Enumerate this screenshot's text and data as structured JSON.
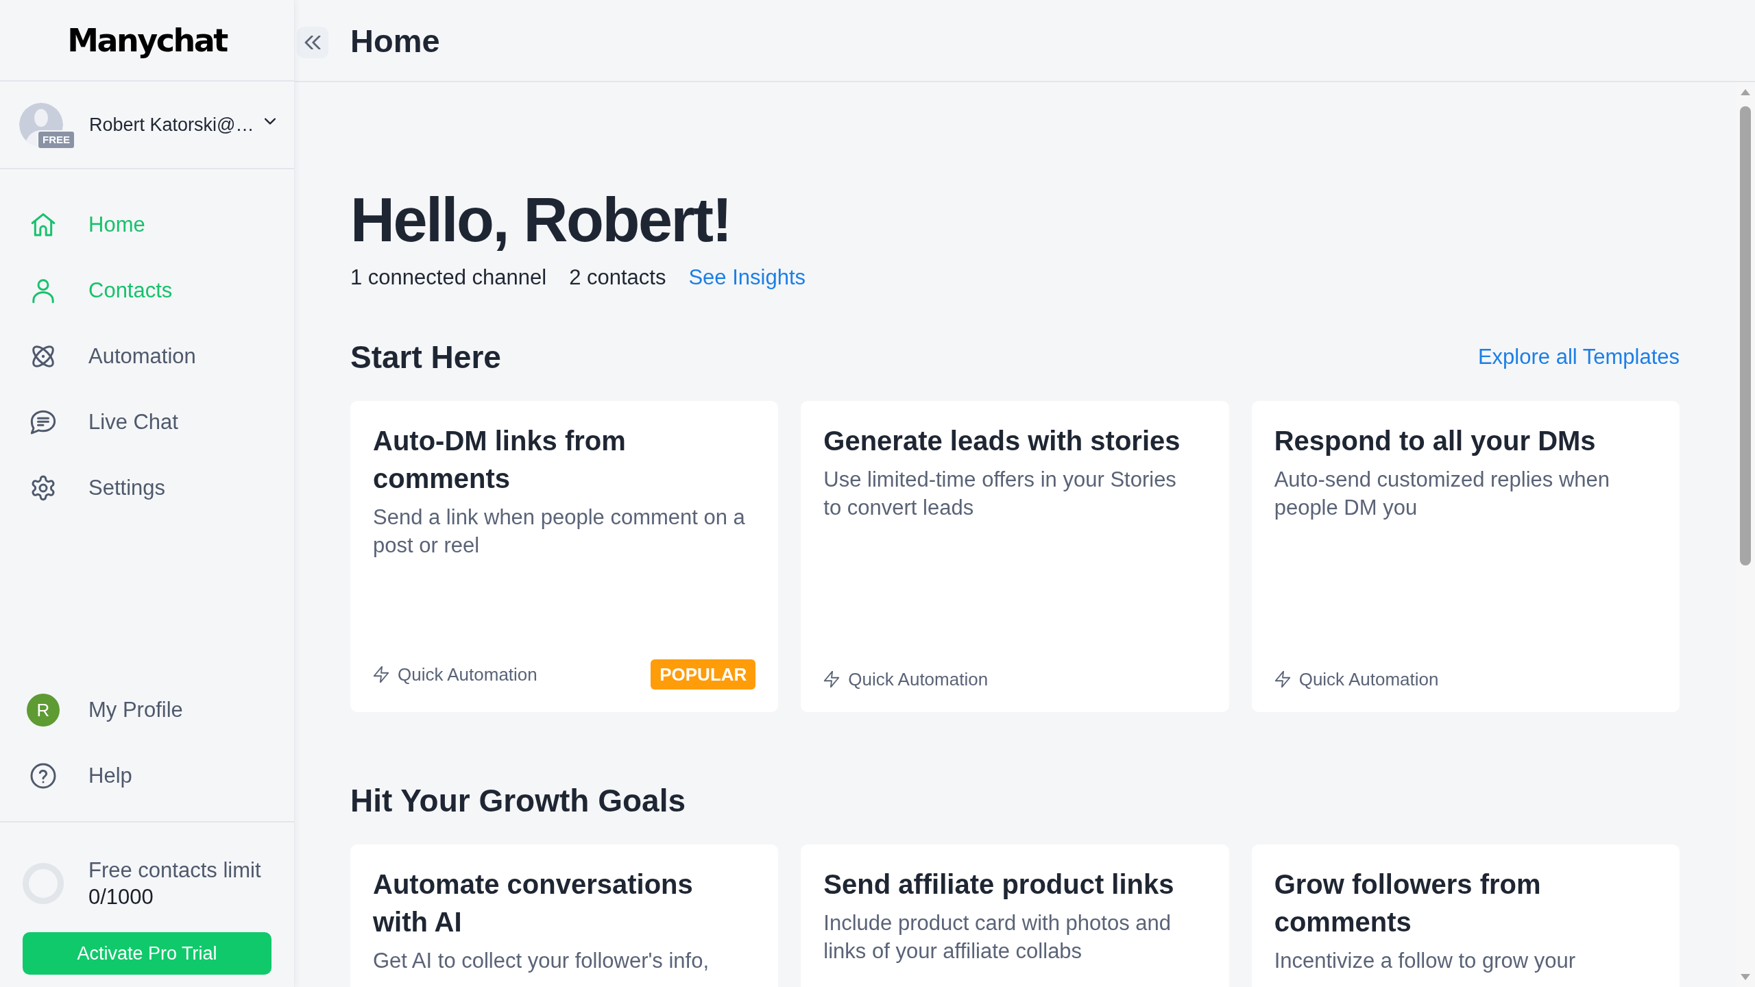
{
  "sidebar": {
    "logo": "Manychat",
    "account": {
      "name": "Robert Katorski@…",
      "badge": "FREE"
    },
    "nav_items": [
      {
        "label": "Home",
        "selected": true
      },
      {
        "label": "Contacts",
        "selected": true
      },
      {
        "label": "Automation",
        "selected": false
      },
      {
        "label": "Live Chat",
        "selected": false
      },
      {
        "label": "Settings",
        "selected": false
      }
    ],
    "bottom_items": [
      {
        "kind": "avatar",
        "avatar_text": "R",
        "label": "My Profile"
      },
      {
        "kind": "help",
        "label": "Help"
      }
    ],
    "contacts_limit": {
      "label": "Free contacts limit",
      "count": "0/1000"
    },
    "upgrade_button": "Activate Pro Trial"
  },
  "header": {
    "title": "Home"
  },
  "greeting": {
    "title": "Hello, Robert!",
    "stats": [
      "1 connected channel",
      "2 contacts"
    ],
    "link": "See Insights"
  },
  "sections": [
    {
      "title": "Start Here",
      "link": "Explore all Templates",
      "cards": [
        {
          "title": "Auto-DM links from comments",
          "description": "Send a link when people comment on a post or reel",
          "footer": "Quick Automation",
          "badge": "POPULAR"
        },
        {
          "title": "Generate leads with stories",
          "description": "Use limited-time offers in your Stories to convert leads",
          "footer": "Quick Automation"
        },
        {
          "title": "Respond to all your DMs",
          "description": "Auto-send customized replies when people DM you",
          "footer": "Quick Automation"
        }
      ]
    },
    {
      "title": "Hit Your Growth Goals",
      "cards": [
        {
          "title": "Automate conversations with AI",
          "description": "Get AI to collect your follower's info,"
        },
        {
          "title": "Send affiliate product links",
          "description": "Include product card with photos and links of your affiliate collabs"
        },
        {
          "title": "Grow followers from comments",
          "description": "Incentivize a follow to grow your"
        }
      ]
    }
  ]
}
